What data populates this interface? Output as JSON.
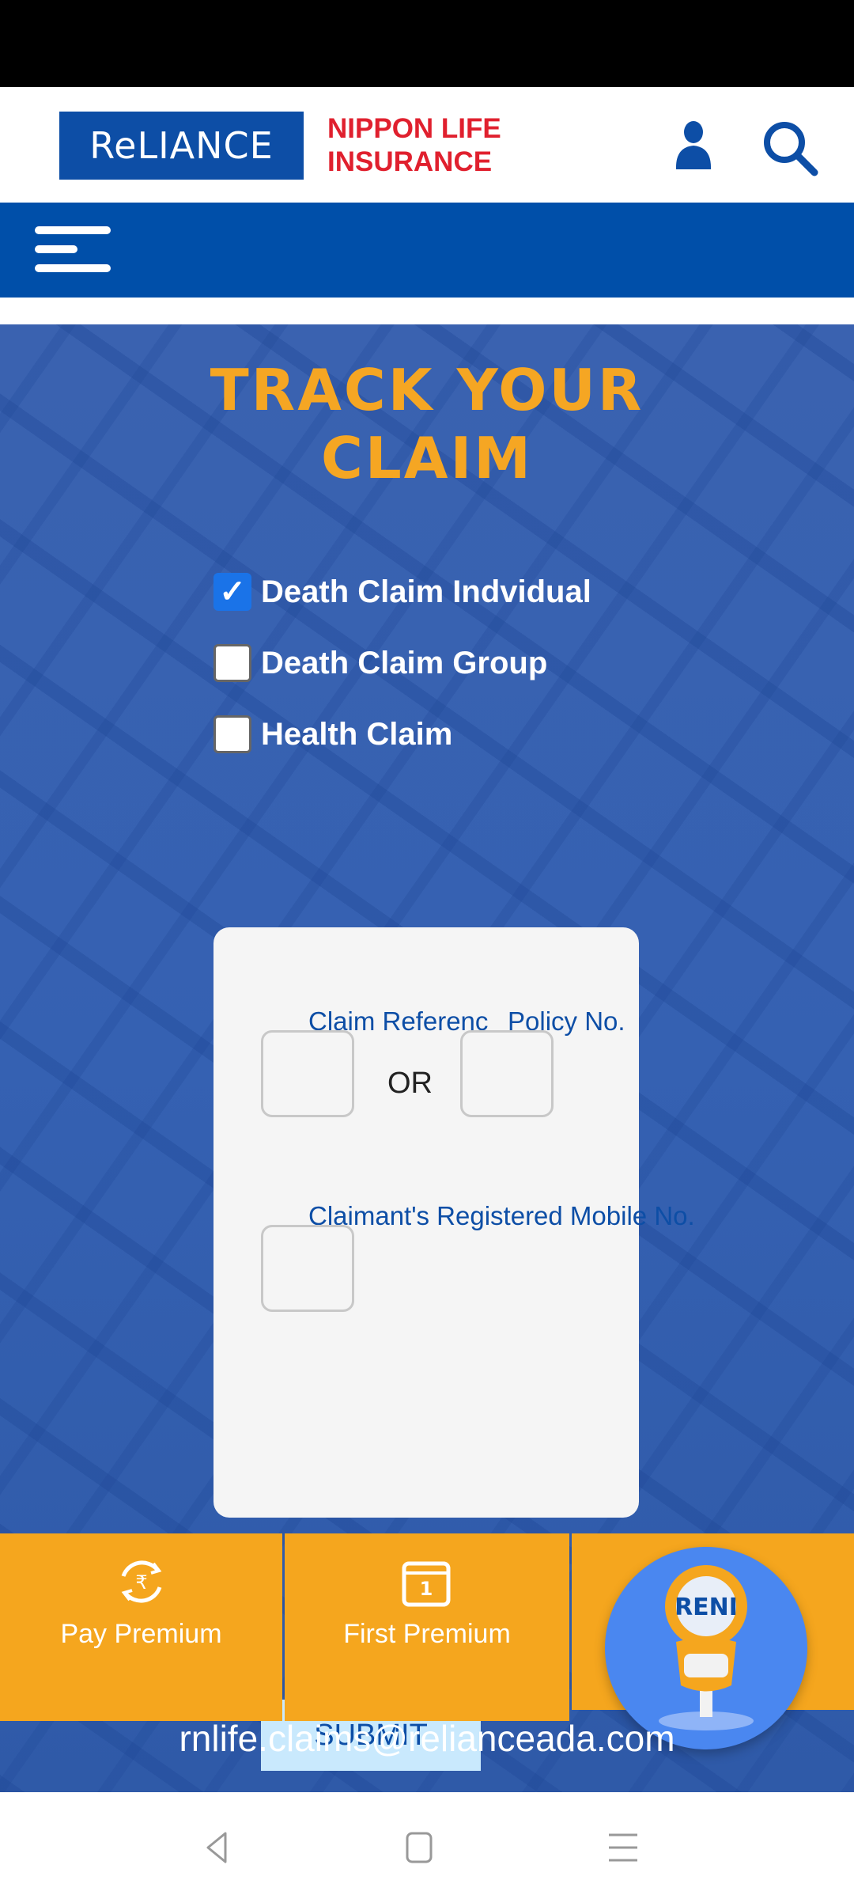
{
  "header": {
    "logo_text": "ReLIANCE",
    "logo_subtitle_line1": "NIPPON LIFE",
    "logo_subtitle_line2": "INSURANCE",
    "brand_blue": "#0d4ea6",
    "brand_red": "#e0202e"
  },
  "nav": {
    "menu_icon": "hamburger-icon",
    "bar_color": "#004fa9"
  },
  "hero": {
    "title_line1": "TRACK YOUR",
    "title_line2": "CLAIM",
    "title_color": "#f5a623",
    "claim_types": [
      {
        "label": "Death Claim Indvidual",
        "checked": true
      },
      {
        "label": "Death Claim Group",
        "checked": false
      },
      {
        "label": "Health Claim",
        "checked": false
      }
    ]
  },
  "form": {
    "claim_reference_label": "Claim Referenc",
    "or_text": "OR",
    "policy_no_label": "Policy No.",
    "mobile_label": "Claimant's Registered Mobile No.",
    "claim_reference_value": "",
    "policy_no_value": "",
    "mobile_value": "",
    "submit_label": "SUBMIT"
  },
  "bottom_bar": {
    "items": [
      {
        "label": "Pay Premium",
        "icon": "rupee-refresh-icon"
      },
      {
        "label": "First Premium",
        "icon": "calendar-one-icon"
      }
    ],
    "chatbot_label": "RENI",
    "accent": "#f5a61e"
  },
  "footer": {
    "email": "rnlife.claims@relianceada.com"
  },
  "system_nav": {
    "back": "back-icon",
    "home": "home-icon",
    "recents": "recents-icon"
  }
}
